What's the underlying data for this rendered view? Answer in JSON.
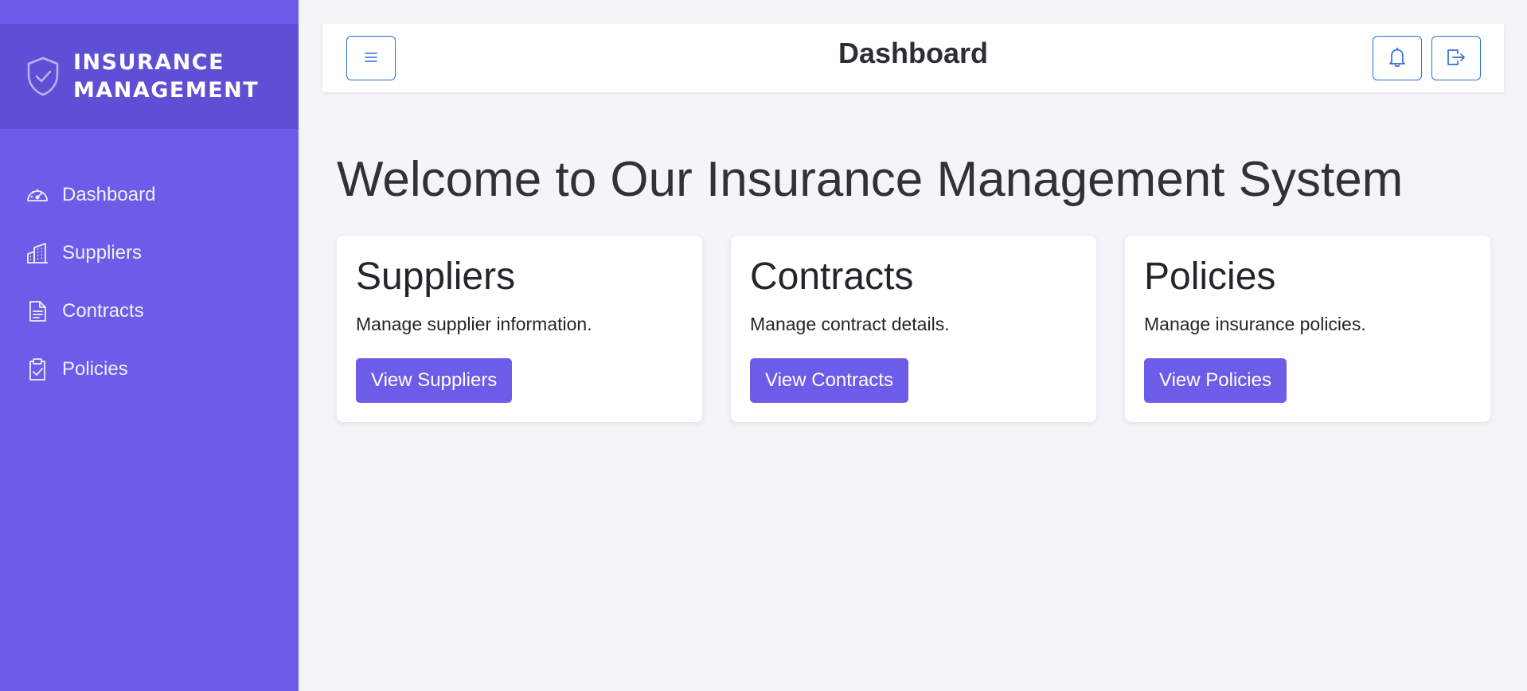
{
  "sidebar": {
    "brand": {
      "line1": "Insurance",
      "line2": "Management",
      "icon": "shield-check-icon"
    },
    "items": [
      {
        "label": "Dashboard",
        "icon": "speedometer-icon"
      },
      {
        "label": "Suppliers",
        "icon": "buildings-icon"
      },
      {
        "label": "Contracts",
        "icon": "document-text-icon"
      },
      {
        "label": "Policies",
        "icon": "clipboard-check-icon"
      }
    ]
  },
  "header": {
    "title": "Dashboard",
    "menu_icon": "hamburger-menu-icon",
    "notifications_icon": "bell-icon",
    "logout_icon": "logout-icon"
  },
  "main": {
    "welcome": "Welcome to Our Insurance Management System",
    "cards": [
      {
        "title": "Suppliers",
        "description": "Manage supplier information.",
        "button": "View Suppliers"
      },
      {
        "title": "Contracts",
        "description": "Manage contract details.",
        "button": "View Contracts"
      },
      {
        "title": "Policies",
        "description": "Manage insurance policies.",
        "button": "View Policies"
      }
    ]
  },
  "colors": {
    "sidebar": "#6c5ce7",
    "brand_band": "#5e4fd4",
    "accent": "#6c5ce7",
    "outline_button": "#2f6fd6",
    "background": "#f4f5f9"
  }
}
